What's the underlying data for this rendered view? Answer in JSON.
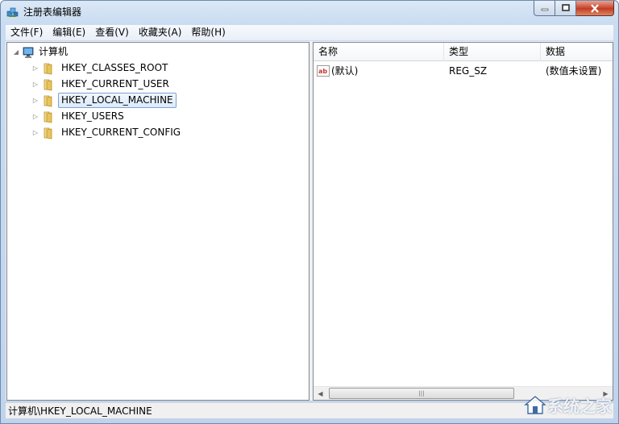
{
  "window": {
    "title": "注册表编辑器"
  },
  "menubar": {
    "items": [
      "文件(F)",
      "编辑(E)",
      "查看(V)",
      "收藏夹(A)",
      "帮助(H)"
    ]
  },
  "tree": {
    "root": {
      "label": "计算机",
      "expanded": true
    },
    "nodes": [
      {
        "label": "HKEY_CLASSES_ROOT",
        "selected": false
      },
      {
        "label": "HKEY_CURRENT_USER",
        "selected": false
      },
      {
        "label": "HKEY_LOCAL_MACHINE",
        "selected": true
      },
      {
        "label": "HKEY_USERS",
        "selected": false
      },
      {
        "label": "HKEY_CURRENT_CONFIG",
        "selected": false
      }
    ]
  },
  "listview": {
    "columns": [
      "名称",
      "类型",
      "数据"
    ],
    "rows": [
      {
        "name": "(默认)",
        "type": "REG_SZ",
        "data": "(数值未设置)"
      }
    ]
  },
  "statusbar": {
    "path": "计算机\\HKEY_LOCAL_MACHINE"
  },
  "watermark": {
    "text": "系统之家"
  },
  "colors": {
    "selection_border": "#7da2ce",
    "folder": "#e8c45a",
    "close_button": "#c9462c"
  }
}
